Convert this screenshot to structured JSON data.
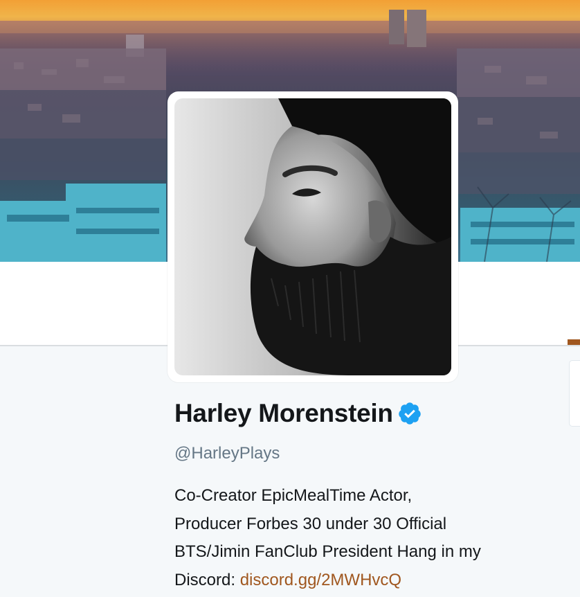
{
  "profile": {
    "name": "Harley Morenstein",
    "verified": true,
    "handle": "@HarleyPlays",
    "bio": {
      "line1": "Co-Creator EpicMealTime Actor,",
      "line2": "Producer Forbes 30 under 30 Official",
      "line3": "BTS/Jimin FanClub President Hang in my",
      "line4_prefix": "Discord: ",
      "link": "discord.gg/2MWHvcQ"
    }
  },
  "colors": {
    "link": "#a0571f",
    "verified_badge": "#1da1f2",
    "name_text": "#14171a",
    "handle_text": "#657786",
    "page_background": "#f5f8fa"
  },
  "icons": {
    "verified": "verified-badge-icon"
  }
}
